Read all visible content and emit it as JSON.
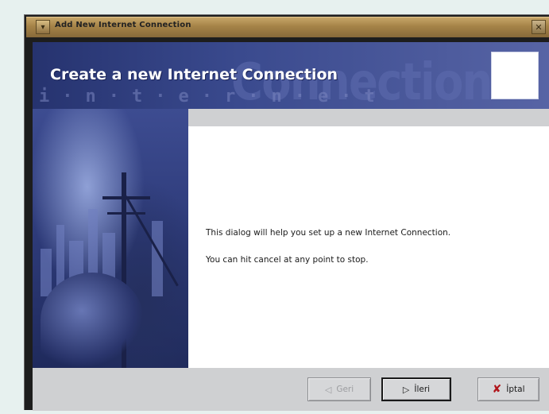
{
  "window": {
    "title": "Add New Internet Connection",
    "menu_icon": "window-menu-icon",
    "close_icon": "window-close-icon"
  },
  "banner": {
    "heading": "Create a new Internet Connection",
    "watermark": "Connection",
    "watermark_dots": "i·n·t·e·r·n·e·t"
  },
  "content": {
    "line1": "This dialog will help you set up a new Internet Connection.",
    "line2": "You can hit cancel at any point to stop."
  },
  "buttons": {
    "back": {
      "label": "Geri",
      "icon": "back-arrow-icon",
      "enabled": false
    },
    "next": {
      "label": "İleri",
      "icon": "next-arrow-icon",
      "enabled": true
    },
    "cancel": {
      "label": "İptal",
      "icon": "cancel-x-icon",
      "enabled": true
    }
  },
  "colors": {
    "titlebar": "#a68448",
    "banner": "#3a4a8e",
    "background": "#e7f1ef",
    "cancel_icon": "#b0141a"
  }
}
